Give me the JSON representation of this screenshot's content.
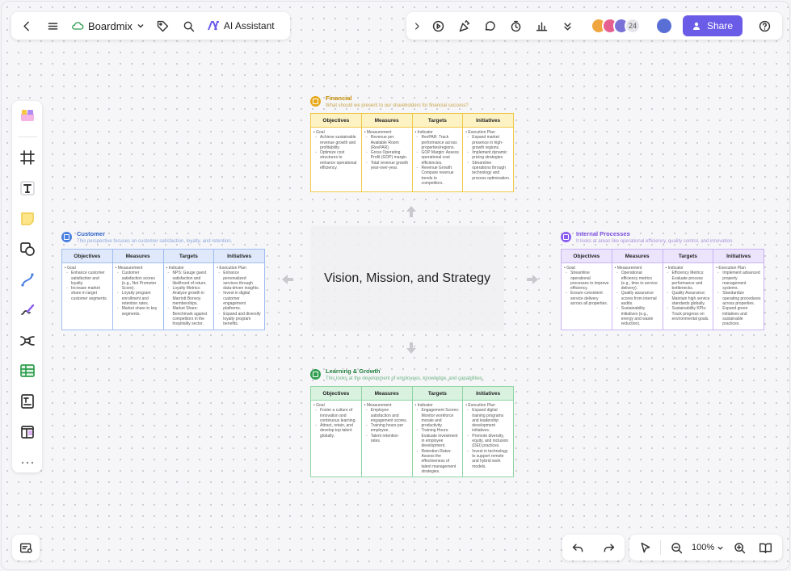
{
  "toolbar_left": {
    "brand": "Boardmix",
    "ai_label": "AI Assistant"
  },
  "toolbar_right": {
    "collaborator_count": "24",
    "share_label": "Share"
  },
  "zoom": {
    "level": "100%"
  },
  "center_title": "Vision, Mission, and Strategy",
  "columns": [
    "Objectives",
    "Measures",
    "Targets",
    "Initiatives"
  ],
  "colors": {
    "accent": "#6b5ce7",
    "financial": "#e6a817",
    "customer": "#4a7fe0",
    "internal": "#8a5cf0",
    "learning": "#2f9e4f"
  },
  "sections": {
    "financial": {
      "title": "Financial",
      "subtitle": "What should we present to our shareholders for financial success?",
      "cells": [
        {
          "head": "Goal",
          "items": [
            "Achieve sustainable revenue growth and profitability.",
            "Optimize cost structures to enhance operational efficiency."
          ]
        },
        {
          "head": "Measurement",
          "items": [
            "Revenue per Available Room (RevPAR).",
            "Gross Operating Profit (GOP) margin.",
            "Total revenue growth year-over-year."
          ]
        },
        {
          "head": "Indicator",
          "items": [
            "RevPAR: Track performance across properties/regions.",
            "GOP Margin: Assess operational cost efficiencies.",
            "Revenue Growth: Compare revenue trends to competitors."
          ]
        },
        {
          "head": "Execution Plan",
          "items": [
            "Expand market presence in high-growth regions.",
            "Implement dynamic pricing strategies.",
            "Streamline operations through technology and process optimization."
          ]
        }
      ]
    },
    "customer": {
      "title": "Customer",
      "subtitle": "This perspective focuses on customer satisfaction, loyalty, and retention.",
      "cells": [
        {
          "head": "Goal",
          "items": [
            "Enhance customer satisfaction and loyalty.",
            "Increase market share in target customer segments."
          ]
        },
        {
          "head": "Measurement",
          "items": [
            "Customer satisfaction scores (e.g., Net Promoter Score).",
            "Loyalty program enrollment and retention rates.",
            "Market share in key segments."
          ]
        },
        {
          "head": "Indicator",
          "items": [
            "NPS: Gauge guest satisfaction and likelihood of return.",
            "Loyalty Metrics: Analyze growth in Marriott Bonvoy memberships.",
            "Market Share: Benchmark against competitors in the hospitality sector."
          ]
        },
        {
          "head": "Execution Plan",
          "items": [
            "Enhance personalized services through data-driven insights.",
            "Invest in digital customer engagement platforms.",
            "Expand and diversify loyalty program benefits."
          ]
        }
      ]
    },
    "internal": {
      "title": "Internal Processes",
      "subtitle": "It looks at areas like operational efficiency, quality control, and innovation.",
      "cells": [
        {
          "head": "Goal",
          "items": [
            "Streamline operational processes to improve efficiency.",
            "Ensure consistent service delivery across all properties."
          ]
        },
        {
          "head": "Measurement",
          "items": [
            "Operational efficiency metrics (e.g., time to service delivery).",
            "Quality assurance scores from internal audits.",
            "Sustainability initiatives (e.g., energy and waste reduction)."
          ]
        },
        {
          "head": "Indicator",
          "items": [
            "Efficiency Metrics: Evaluate process performance and bottlenecks.",
            "Quality Assurance: Maintain high service standards globally.",
            "Sustainability KPIs: Track progress on environmental goals."
          ]
        },
        {
          "head": "Execution Plan",
          "items": [
            "Implement advanced property management systems.",
            "Standardize operating procedures across properties.",
            "Expand green initiatives and sustainable practices."
          ]
        }
      ]
    },
    "learning": {
      "title": "Learning & Growth",
      "subtitle": "This looks at the development of employees, knowledge, and capabilities.",
      "cells": [
        {
          "head": "Goal",
          "items": [
            "Foster a culture of innovation and continuous learning.",
            "Attract, retain, and develop top talent globally."
          ]
        },
        {
          "head": "Measurement",
          "items": [
            "Employee satisfaction and engagement scores.",
            "Training hours per employee.",
            "Talent retention rates."
          ]
        },
        {
          "head": "Indicator",
          "items": [
            "Engagement Scores: Monitor workforce morale and productivity.",
            "Training Hours: Evaluate investment in employee development.",
            "Retention Rates: Assess the effectiveness of talent management strategies."
          ]
        },
        {
          "head": "Execution Plan",
          "items": [
            "Expand digital training programs and leadership development initiatives.",
            "Promote diversity, equity, and inclusion (DEI) practices.",
            "Invest in technology to support remote and hybrid work models."
          ]
        }
      ]
    }
  }
}
